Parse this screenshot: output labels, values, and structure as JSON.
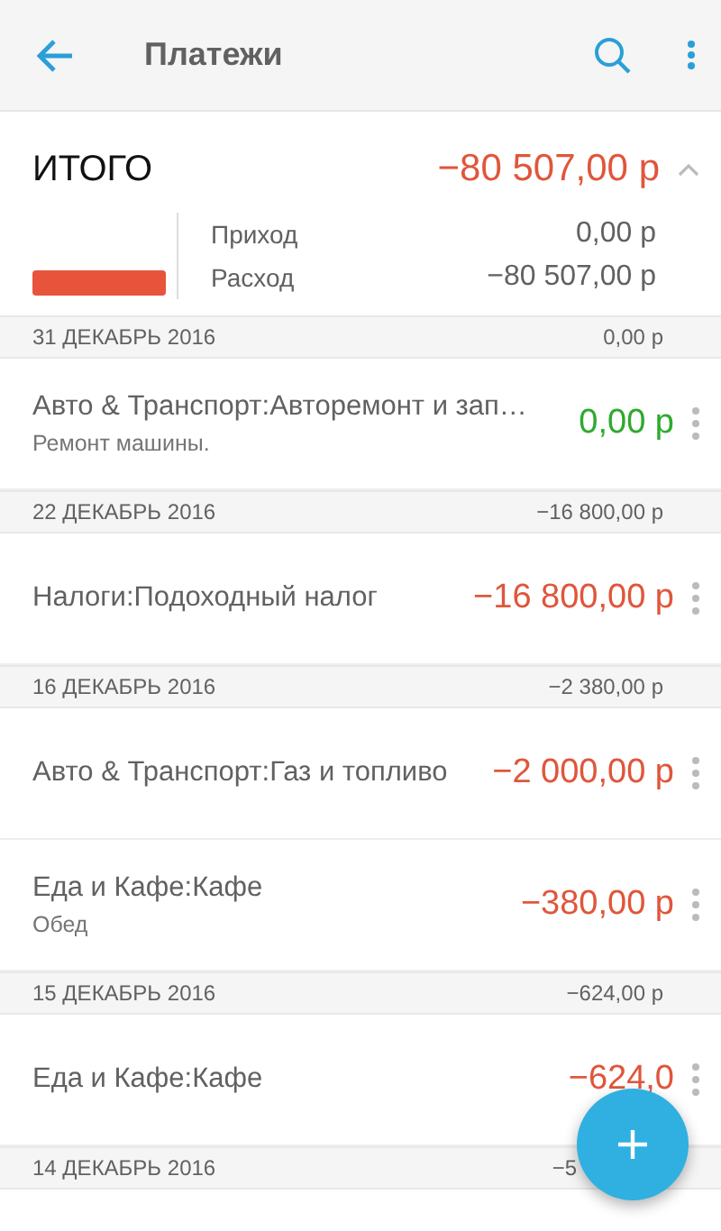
{
  "app_bar": {
    "title": "Платежи"
  },
  "summary": {
    "label": "ИТОГО",
    "total": "−80 507,00 р",
    "expanded": true,
    "rows": [
      {
        "label": "Приход",
        "value": "0,00 р"
      },
      {
        "label": "Расход",
        "value": "−80 507,00 р"
      }
    ]
  },
  "groups": [
    {
      "date": "31 ДЕКАБРЬ 2016",
      "total": "0,00 р",
      "items": [
        {
          "title": "Авто & Транспорт:Авторемонт и зап…",
          "note": "Ремонт машины.",
          "amount": "0,00 р",
          "color": "#2eaa2e"
        }
      ]
    },
    {
      "date": "22 ДЕКАБРЬ 2016",
      "total": "−16 800,00 р",
      "items": [
        {
          "title": "Налоги:Подоходный налог",
          "amount": "−16 800,00 р",
          "color": "#e0563b"
        }
      ]
    },
    {
      "date": "16 ДЕКАБРЬ 2016",
      "total": "−2 380,00 р",
      "items": [
        {
          "title": "Авто & Транспорт:Газ и топливо",
          "amount": "−2 000,00 р",
          "color": "#e0563b"
        },
        {
          "title": "Еда и Кафе:Кафе",
          "note": "Обед",
          "amount": "−380,00 р",
          "color": "#e0563b"
        }
      ]
    },
    {
      "date": "15 ДЕКАБРЬ 2016",
      "total": "−624,00 р",
      "items": [
        {
          "title": "Еда и Кафе:Кафе",
          "amount": "−624,0",
          "color": "#e0563b"
        }
      ]
    },
    {
      "date": "14 ДЕКАБРЬ 2016",
      "total": "−5"
    }
  ]
}
